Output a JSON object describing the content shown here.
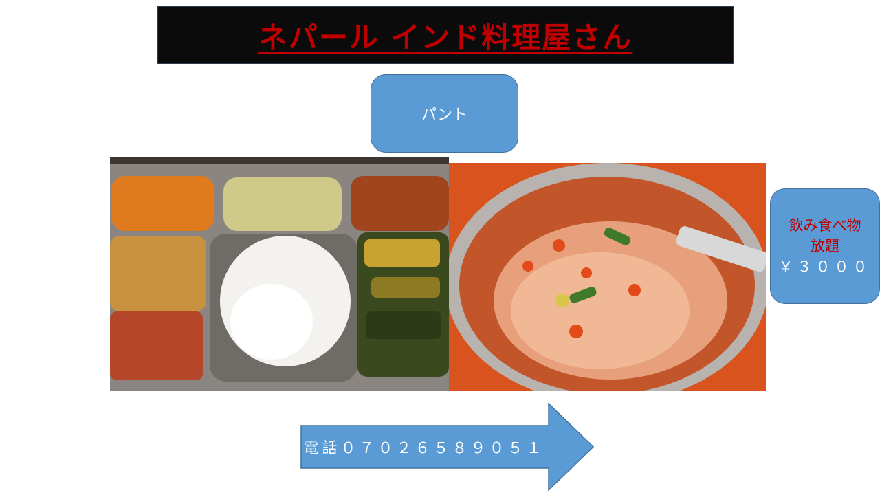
{
  "title": "ネパール インド料理屋さん",
  "pant_label": "パント",
  "offer": {
    "line1": "飲み食べ物",
    "line2": "放題",
    "price": "￥３０００"
  },
  "phone": "電話０７０２６５８９０５１",
  "colors": {
    "title_bg": "#0b0b0b",
    "title_text": "#c00000",
    "box_fill": "#5b9bd5",
    "offer_text": "#c00000"
  },
  "images": {
    "left": "thali-plate",
    "right": "spaghetti-bowl"
  }
}
